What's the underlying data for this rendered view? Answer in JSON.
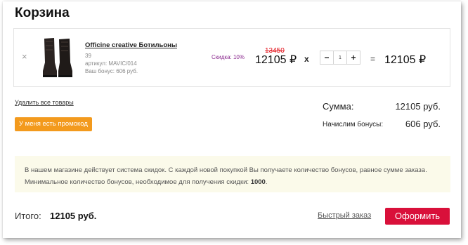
{
  "page": {
    "title": "Корзина"
  },
  "cart": {
    "remove_icon": "close-icon",
    "item": {
      "name": "Officine creative Ботильоны",
      "size": "39",
      "article": "артикул: MAVIC/014",
      "bonus": "Ваш бонус: 606 руб.",
      "discount": "Скидка: 10%",
      "old_price": "13450",
      "price": "12105 ₽",
      "times": "x",
      "quantity": "1",
      "minus": "−",
      "plus": "+",
      "equals": "=",
      "total": "12105 ₽"
    }
  },
  "actions": {
    "clear_all": "Удалить все товары",
    "promo": "У меня есть промокод"
  },
  "summary": {
    "sum_label": "Сумма:",
    "sum_value": "12105 руб.",
    "bonus_label": "Начислим бонусы:",
    "bonus_value": "606 руб."
  },
  "notice": {
    "text": "В нашем магазине действует система скидок. С каждой новой покупкой Вы получаете количество бонусов, равное сумме заказа. Минимальное количество бонусов, необходимое для получения скидки: ",
    "amount": "1000",
    "end": "."
  },
  "footer": {
    "total_label": "Итого:",
    "total_value": "12105 руб.",
    "quick_order": "Быстрый заказ",
    "checkout": "Оформить"
  },
  "colors": {
    "promo": "#f39a1d",
    "checkout": "#d9103a",
    "old_price": "#e3161f",
    "discount": "#8b2a8f",
    "notice_bg": "#fbfaea"
  }
}
